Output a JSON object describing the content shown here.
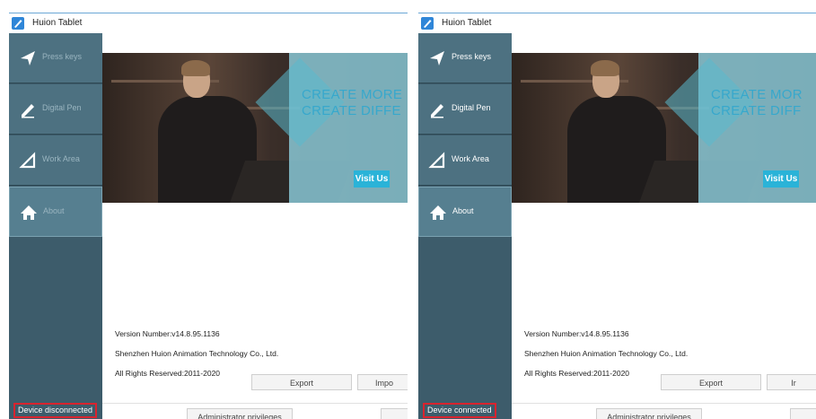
{
  "windows": [
    {
      "title": "Huion Tablet",
      "nav": [
        {
          "label": "Press keys",
          "icon": "send-arrow-icon"
        },
        {
          "label": "Digital Pen",
          "icon": "pen-icon"
        },
        {
          "label": "Work Area",
          "icon": "triangle-area-icon"
        },
        {
          "label": "About",
          "icon": "home-icon",
          "active": true
        }
      ],
      "device_status": "Device disconnected",
      "banner": {
        "line1": "CREATE MORE",
        "line2": "CREATE DIFFE",
        "visit": "Visit Us"
      },
      "version": "Version Number:v14.8.95.1136",
      "company": "Shenzhen Huion Animation Technology Co., Ltd.",
      "rights": "All Rights Reserved:2011-2020",
      "export_label": "Export",
      "import_label": "Impo",
      "admin_label": "Administrator privileges"
    },
    {
      "title": "Huion Tablet",
      "nav": [
        {
          "label": "Press keys",
          "icon": "send-arrow-icon"
        },
        {
          "label": "Digital Pen",
          "icon": "pen-icon"
        },
        {
          "label": "Work Area",
          "icon": "triangle-area-icon"
        },
        {
          "label": "About",
          "icon": "home-icon",
          "active": true
        }
      ],
      "device_status": "Device connected",
      "banner": {
        "line1": "CREATE MOR",
        "line2": "CREATE DIFF",
        "visit": "Visit Us"
      },
      "version": "Version Number:v14.8.95.1136",
      "company": "Shenzhen Huion Animation Technology Co., Ltd.",
      "rights": "All Rights Reserved:2011-2020",
      "export_label": "Export",
      "import_label": "Ir",
      "admin_label": "Administrator privileges"
    }
  ],
  "colors": {
    "sidebar": "#3d5c6b",
    "nav_item": "#4d7181",
    "highlight_box": "#d9232e",
    "banner_text": "#37a8cc",
    "visit_button": "#2ab3d8"
  }
}
